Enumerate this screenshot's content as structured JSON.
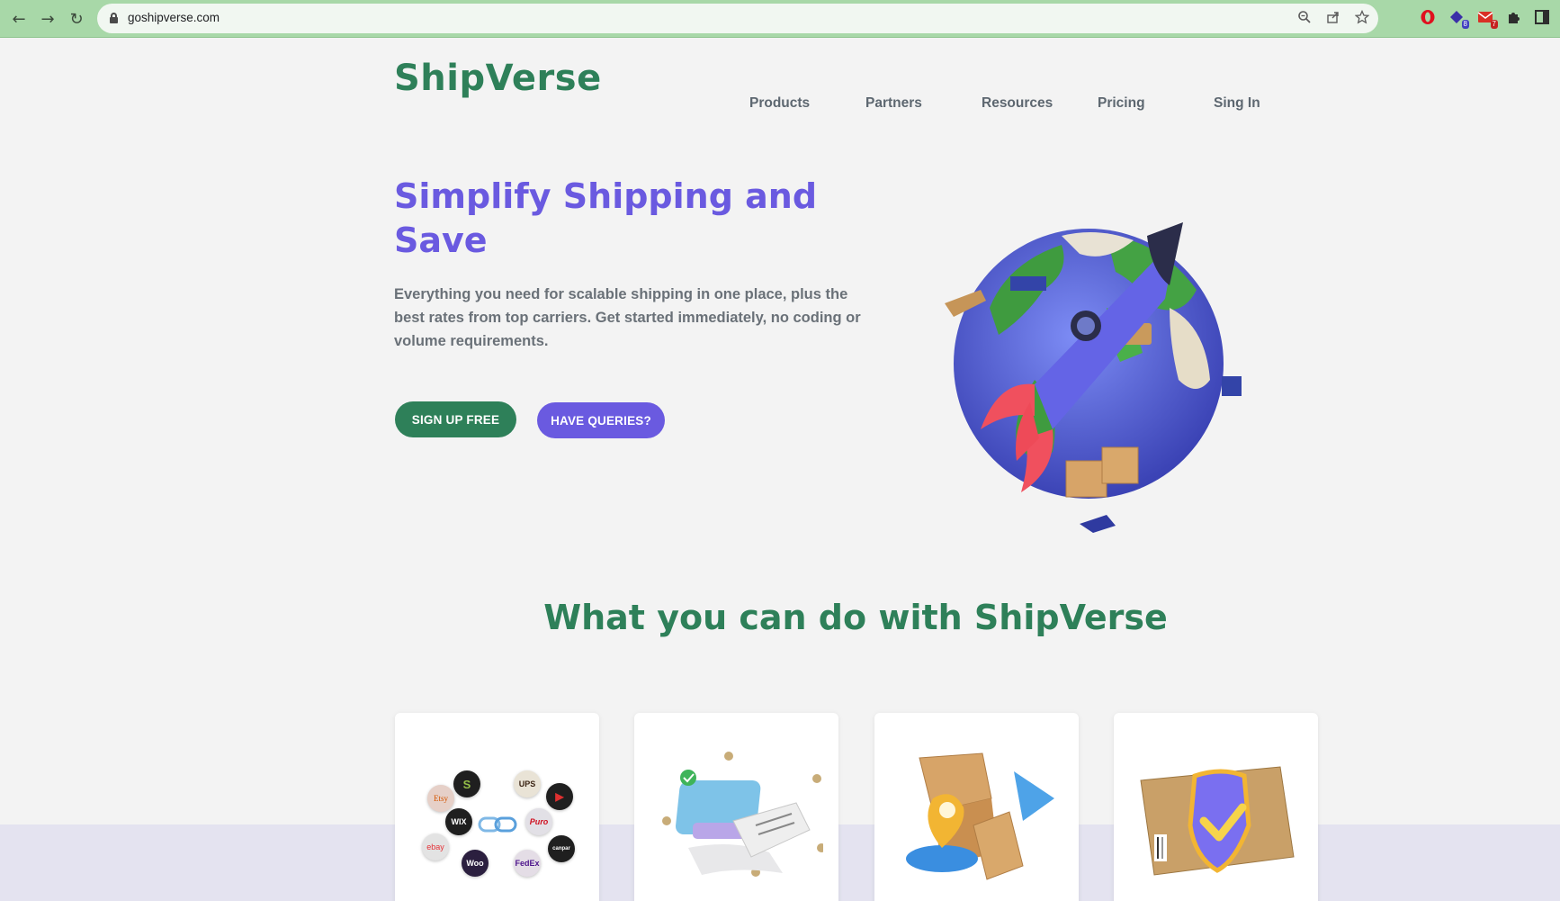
{
  "browser": {
    "url": "goshipverse.com",
    "extension_badges": [
      "8",
      "7"
    ]
  },
  "header": {
    "logo": "ShipVerse",
    "nav": [
      "Products",
      "Partners",
      "Resources",
      "Pricing",
      "Sing In"
    ]
  },
  "hero": {
    "title": "Simplify Shipping and Save",
    "description": "Everything you need for scalable shipping in one place, plus the best rates from top carriers. Get started immediately, no coding or volume requirements.",
    "cta_primary": "SIGN UP FREE",
    "cta_secondary": "HAVE QUERIES?"
  },
  "features": {
    "title": "What you can do with ShipVerse",
    "card1_chips": [
      "Etsy",
      "S",
      "UPS",
      "WIX",
      "Puro",
      "ebay",
      "Woo",
      "FedEx",
      "canpar"
    ]
  },
  "colors": {
    "brand_green": "#2e8059",
    "brand_purple": "#6a5ae0",
    "browser_frame": "#a8d8a8"
  }
}
